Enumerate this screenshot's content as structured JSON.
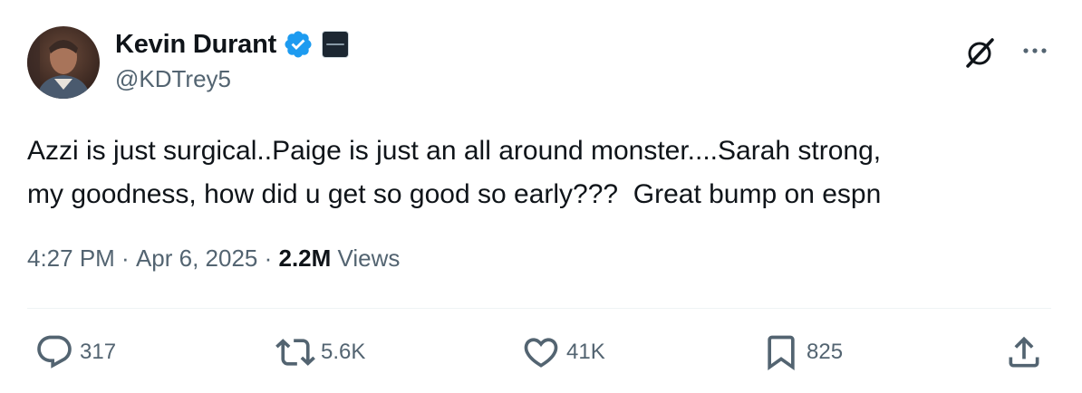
{
  "author": {
    "display_name": "Kevin Durant",
    "handle": "@KDTrey5",
    "verified": true,
    "avatar_icon": "profile-photo"
  },
  "tweet": {
    "text": "Azzi is just surgical..Paige is just an all around monster....Sarah strong,\nmy goodness, how did u get so good so early???  Great bump on espn",
    "time": "4:27 PM",
    "separator": " · ",
    "date": "Apr 6, 2025",
    "views_count": "2.2M",
    "views_label": "Views"
  },
  "actions": {
    "replies": "317",
    "reposts": "5.6K",
    "likes": "41K",
    "bookmarks": "825"
  },
  "colors": {
    "verified": "#1d9bf0",
    "secondary_text": "#536471",
    "primary_text": "#0f1419"
  }
}
